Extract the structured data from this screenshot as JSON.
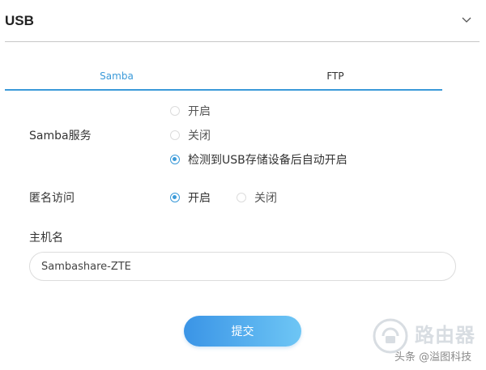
{
  "header": {
    "title": "USB",
    "chevron_icon": "chevron-down-icon"
  },
  "tabs": [
    {
      "label": "Samba",
      "active": true
    },
    {
      "label": "FTP",
      "active": false
    }
  ],
  "colors": {
    "accent": "#3b9ad9",
    "button_gradient_start": "#3a94e6",
    "button_gradient_end": "#6ec6f5"
  },
  "samba_service": {
    "label": "Samba服务",
    "options": [
      {
        "label": "开启",
        "checked": false
      },
      {
        "label": "关闭",
        "checked": false
      },
      {
        "label": "检测到USB存储设备后自动开启",
        "checked": true
      }
    ]
  },
  "anonymous_access": {
    "label": "匿名访问",
    "options": [
      {
        "label": "开启",
        "checked": true
      },
      {
        "label": "关闭",
        "checked": false
      }
    ]
  },
  "hostname": {
    "label": "主机名",
    "value": "Sambashare-ZTE"
  },
  "submit": {
    "label": "提交"
  },
  "watermark": {
    "brand": "路由器",
    "credit": "头条 @溢图科技"
  }
}
